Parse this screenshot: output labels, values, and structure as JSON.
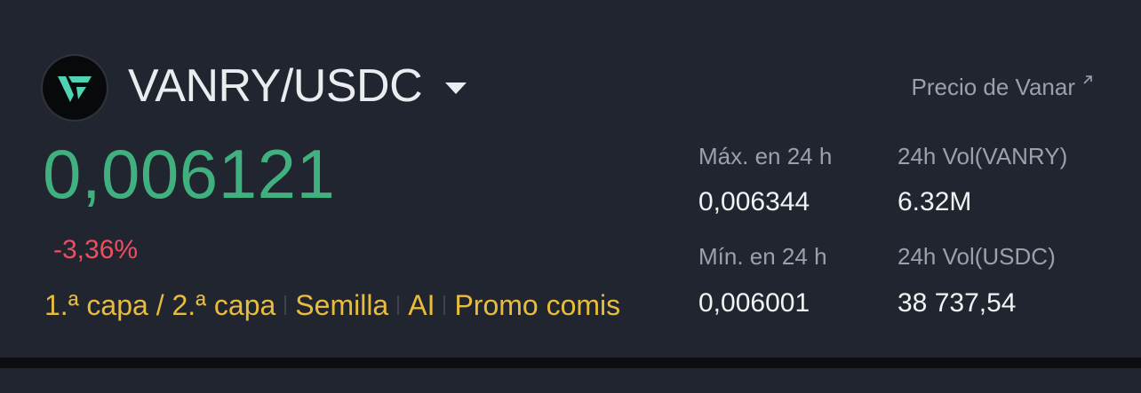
{
  "header": {
    "pair": "VANRY/USDC",
    "price_link": "Precio de Vanar"
  },
  "price": {
    "last": "0,006121",
    "change": "-3,36%"
  },
  "tags": [
    "1.ª capa / 2.ª capa",
    "Semilla",
    "AI",
    "Promo comis"
  ],
  "stats": {
    "high": {
      "label": "Máx. en 24 h",
      "value": "0,006344"
    },
    "low": {
      "label": "Mín. en 24 h",
      "value": "0,006001"
    },
    "vol_base": {
      "label": "24h Vol(VANRY)",
      "value": "6.32M"
    },
    "vol_quote": {
      "label": "24h Vol(USDC)",
      "value": "38 737,54"
    }
  },
  "colors": {
    "background": "#21252f",
    "up": "#40b07e",
    "down": "#ef4d60",
    "tag": "#e9bd3c",
    "logo_mark": "#4ed4b4"
  },
  "icons": [
    "vanar-logo-icon",
    "caret-down-icon",
    "external-arrow-icon"
  ]
}
